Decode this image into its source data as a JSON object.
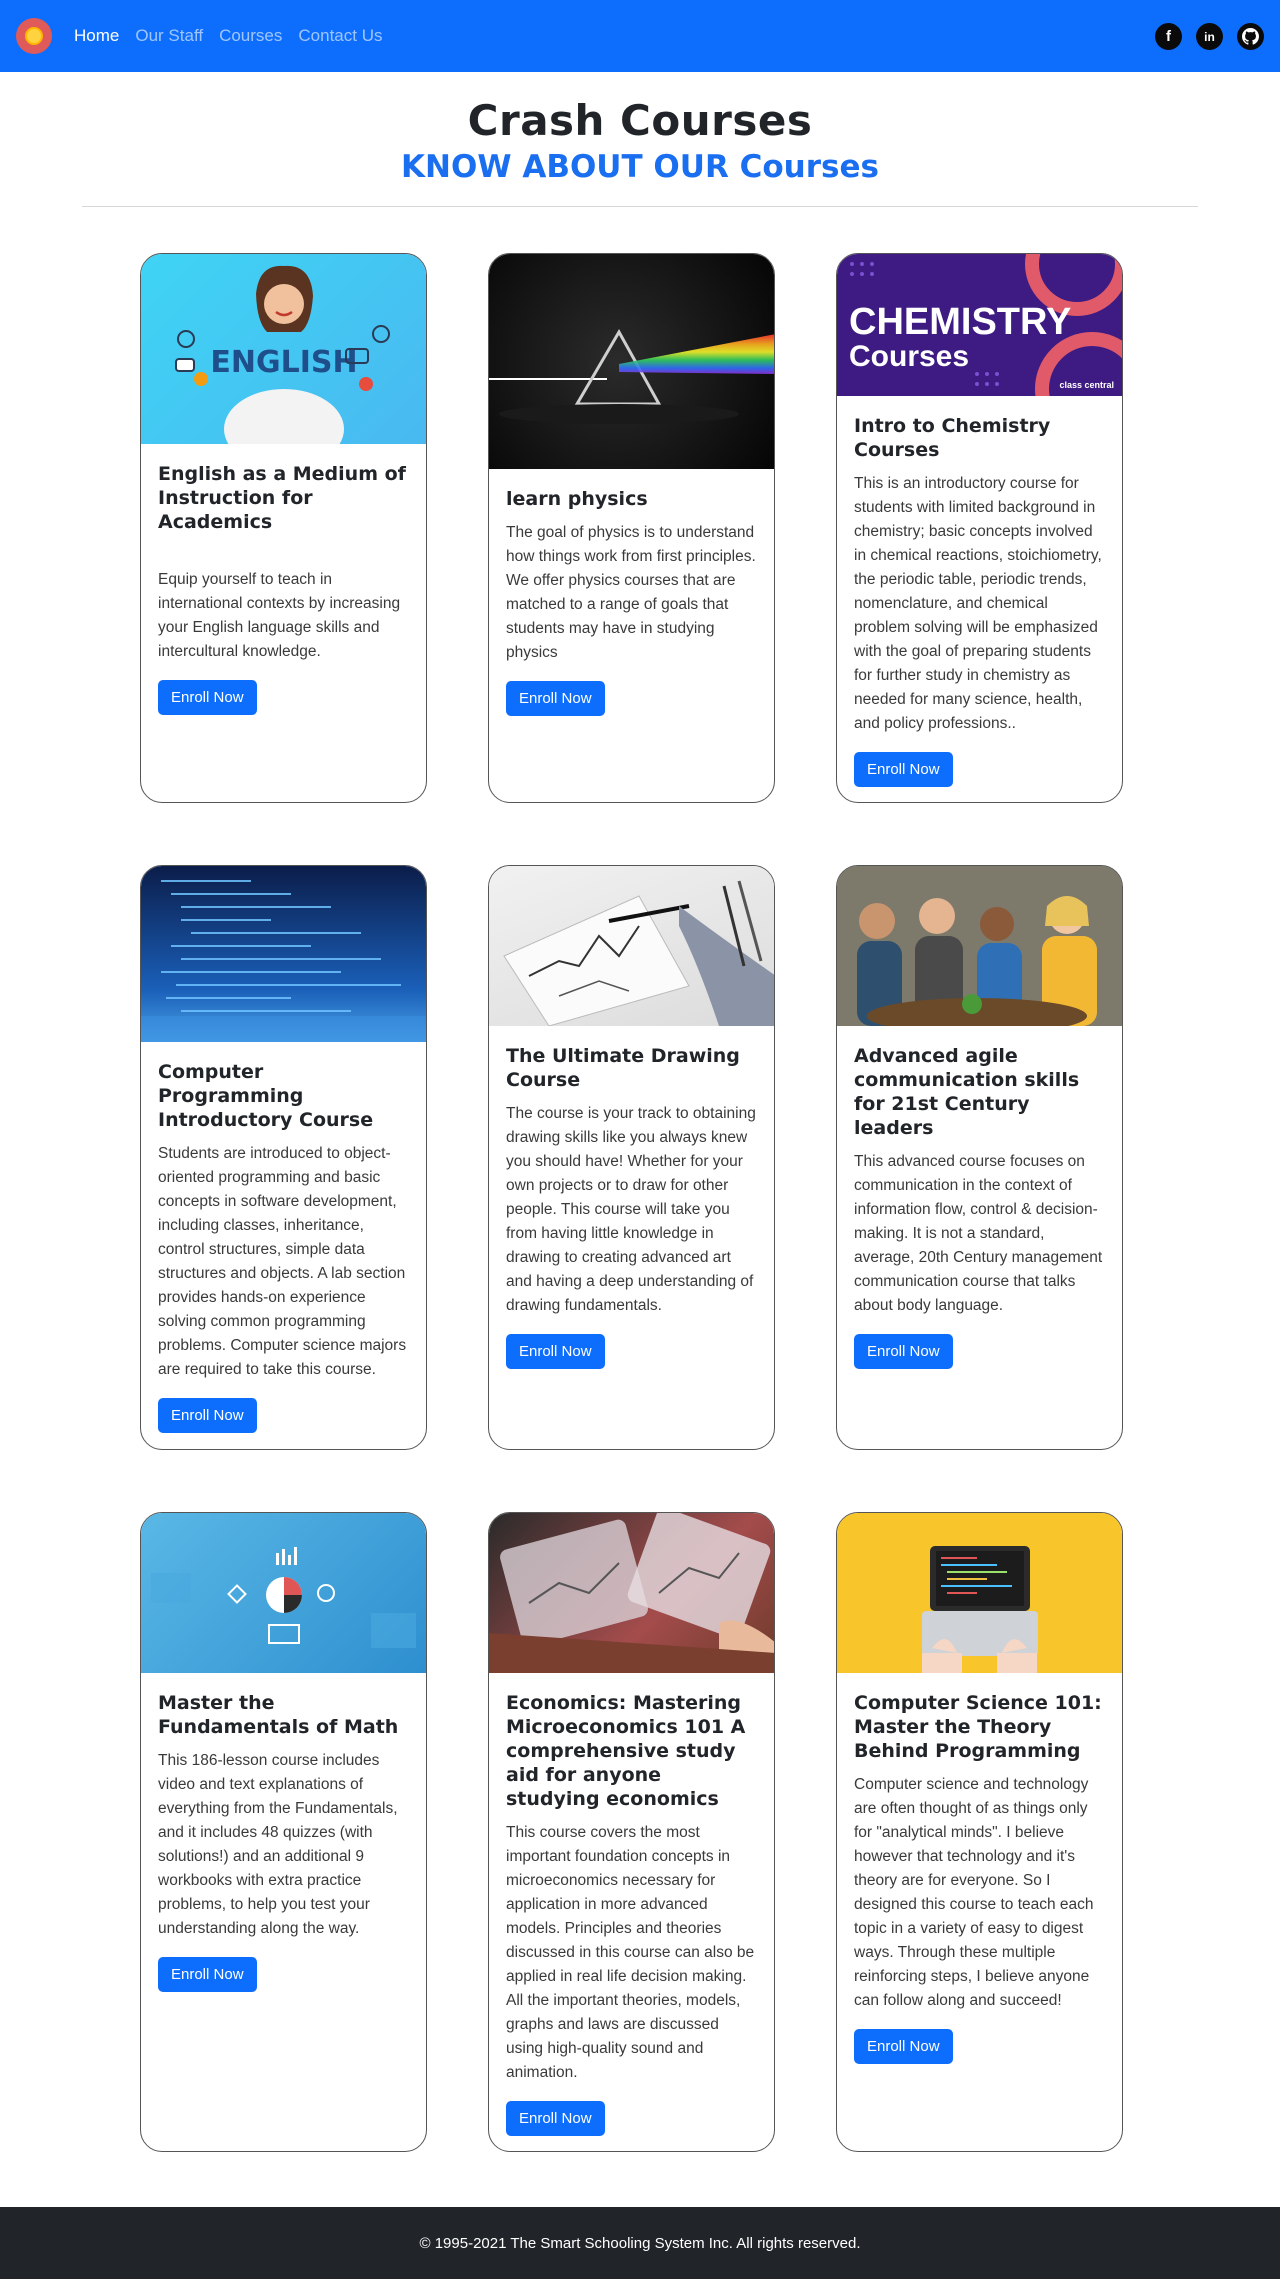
{
  "nav": {
    "links": [
      "Home",
      "Our Staff",
      "Courses",
      "Contact Us"
    ],
    "social": [
      "facebook-icon",
      "linkedin-icon",
      "github-icon"
    ]
  },
  "header": {
    "title": "Crash Courses",
    "subtitle": "KNOW ABOUT OUR Courses"
  },
  "courses": [
    {
      "title": "English as a Medium of Instruction for Academics",
      "text": "Equip yourself to teach in international contexts by increasing your English language skills and intercultural knowledge.",
      "button": "Enroll Now",
      "image_label": "ENGLISH"
    },
    {
      "title": "learn physics",
      "text": "The goal of physics is to understand how things work from first principles. We offer physics courses that are matched to a range of goals that students may have in studying physics",
      "button": "Enroll Now"
    },
    {
      "title": "Intro to Chemistry Courses",
      "text": "This is an introductory course for students with limited background in chemistry; basic concepts involved in chemical reactions, stoichiometry, the periodic table, periodic trends, nomenclature, and chemical problem solving will be emphasized with the goal of preparing students for further study in chemistry as needed for many science, health, and policy professions..",
      "button": "Enroll Now",
      "image_label": "CHEMISTRY",
      "image_label2": "Courses",
      "image_badge": "class central"
    },
    {
      "title": "Computer Programming Introductory Course",
      "text": "Students are introduced to object-oriented programming and basic concepts in software development, including classes, inheritance, control structures, simple data structures and objects. A lab section provides hands-on experience solving common programming problems. Computer science majors are required to take this course.",
      "button": "Enroll Now"
    },
    {
      "title": "The Ultimate Drawing Course",
      "text": "The course is your track to obtaining drawing skills like you always knew you should have! Whether for your own projects or to draw for other people. This course will take you from having little knowledge in drawing to creating advanced art and having a deep understanding of drawing fundamentals.",
      "button": "Enroll Now"
    },
    {
      "title": "Advanced agile communication skills for 21st Century leaders",
      "text": "This advanced course focuses on communication in the context of information flow, control & decision-making. It is not a standard, average, 20th Century management communication course that talks about body language.",
      "button": "Enroll Now"
    },
    {
      "title": "Master the Fundamentals of Math",
      "text": "This 186-lesson course includes video and text explanations of everything from the Fundamentals, and it includes 48 quizzes (with solutions!) and an additional 9 workbooks with extra practice problems, to help you test your understanding along the way.",
      "button": "Enroll Now"
    },
    {
      "title": "Economics: Mastering Microeconomics 101 A comprehensive study aid for anyone studying economics",
      "text": "This course covers the most important foundation concepts in microeconomics necessary for application in more advanced models. Principles and theories discussed in this course can also be applied in real life decision making. All the important theories, models, graphs and laws are discussed using high-quality sound and animation.",
      "button": "Enroll Now"
    },
    {
      "title": "Computer Science 101: Master the Theory Behind Programming",
      "text": "Computer science and technology are often thought of as things only for \"analytical minds\". I believe however that technology and it's theory are for everyone. So I designed this course to teach each topic in a variety of easy to digest ways. Through these multiple reinforcing steps, I believe anyone can follow along and succeed!",
      "button": "Enroll Now"
    }
  ],
  "footer": {
    "text": "© 1995-2021 The Smart Schooling System Inc. All rights reserved."
  },
  "colors": {
    "primary": "#0d6efd",
    "subtitle": "#1a6ef0",
    "footer_bg": "#212529"
  }
}
